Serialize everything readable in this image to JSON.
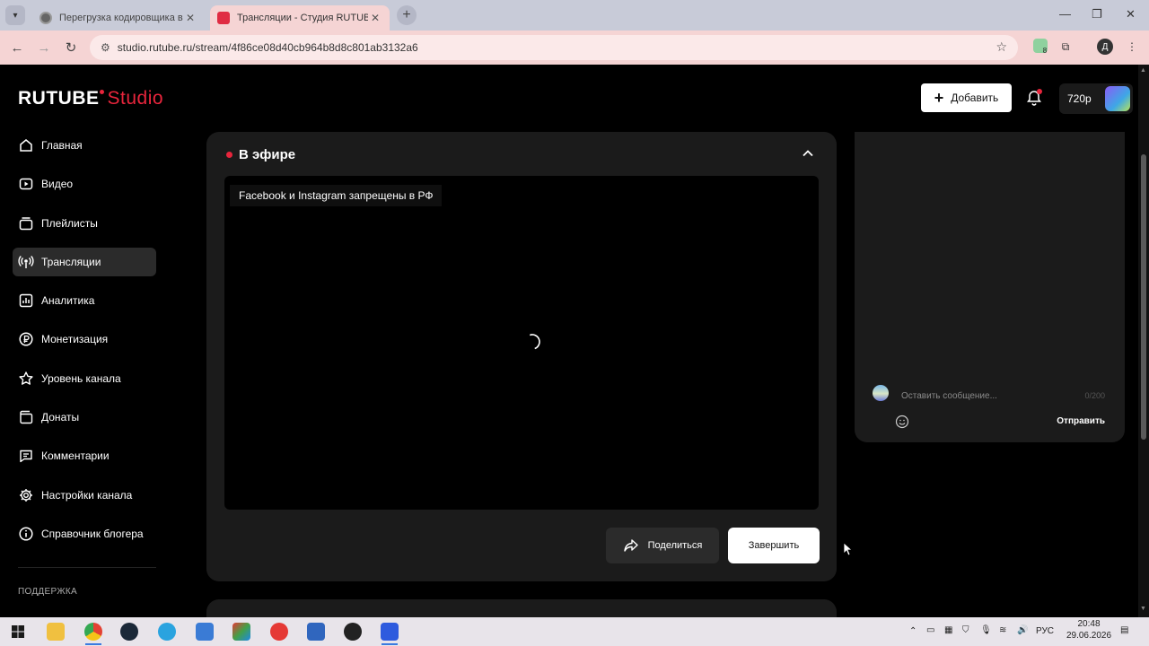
{
  "browser": {
    "tabs": [
      {
        "title": "Перегрузка кодировщика в п",
        "active": false
      },
      {
        "title": "Трансляции - Студия RUTUBE",
        "active": true
      }
    ],
    "url": "studio.rutube.ru/stream/4f86ce08d40cb964b8d8c801ab3132a6",
    "profile_initial": "Д",
    "extension_badge": "8"
  },
  "header": {
    "logo_main": "RUTUBE",
    "logo_studio": "Studio",
    "add_label": "Добавить",
    "balance": "720р"
  },
  "sidebar": {
    "items": [
      {
        "label": "Главная",
        "icon": "home-icon",
        "active": false
      },
      {
        "label": "Видео",
        "icon": "video-icon",
        "active": false
      },
      {
        "label": "Плейлисты",
        "icon": "playlist-icon",
        "active": false
      },
      {
        "label": "Трансляции",
        "icon": "broadcast-icon",
        "active": true
      },
      {
        "label": "Аналитика",
        "icon": "analytics-icon",
        "active": false
      },
      {
        "label": "Монетизация",
        "icon": "ruble-icon",
        "active": false
      },
      {
        "label": "Уровень канала",
        "icon": "star-icon",
        "active": false
      },
      {
        "label": "Донаты",
        "icon": "wallet-icon",
        "active": false
      },
      {
        "label": "Комментарии",
        "icon": "comment-icon",
        "active": false
      },
      {
        "label": "Настройки канала",
        "icon": "gear-icon",
        "active": false
      },
      {
        "label": "Справочник блогера",
        "icon": "info-icon",
        "active": false
      }
    ],
    "support_label": "ПОДДЕРЖКА"
  },
  "stream": {
    "status_label": "В эфире",
    "player_notice": "Facebook и Instagram запрещены в РФ",
    "share_label": "Поделиться",
    "end_label": "Завершить"
  },
  "chat": {
    "input_placeholder": "Оставить сообщение...",
    "counter": "0/200",
    "send_label": "Отправить"
  },
  "taskbar": {
    "language": "РУС",
    "time": "20:48",
    "date": "29.06.2026"
  },
  "colors": {
    "accent": "#e8253c",
    "background": "#000000",
    "card": "#1b1b1b",
    "browser_tab": "#f5d4d4"
  }
}
